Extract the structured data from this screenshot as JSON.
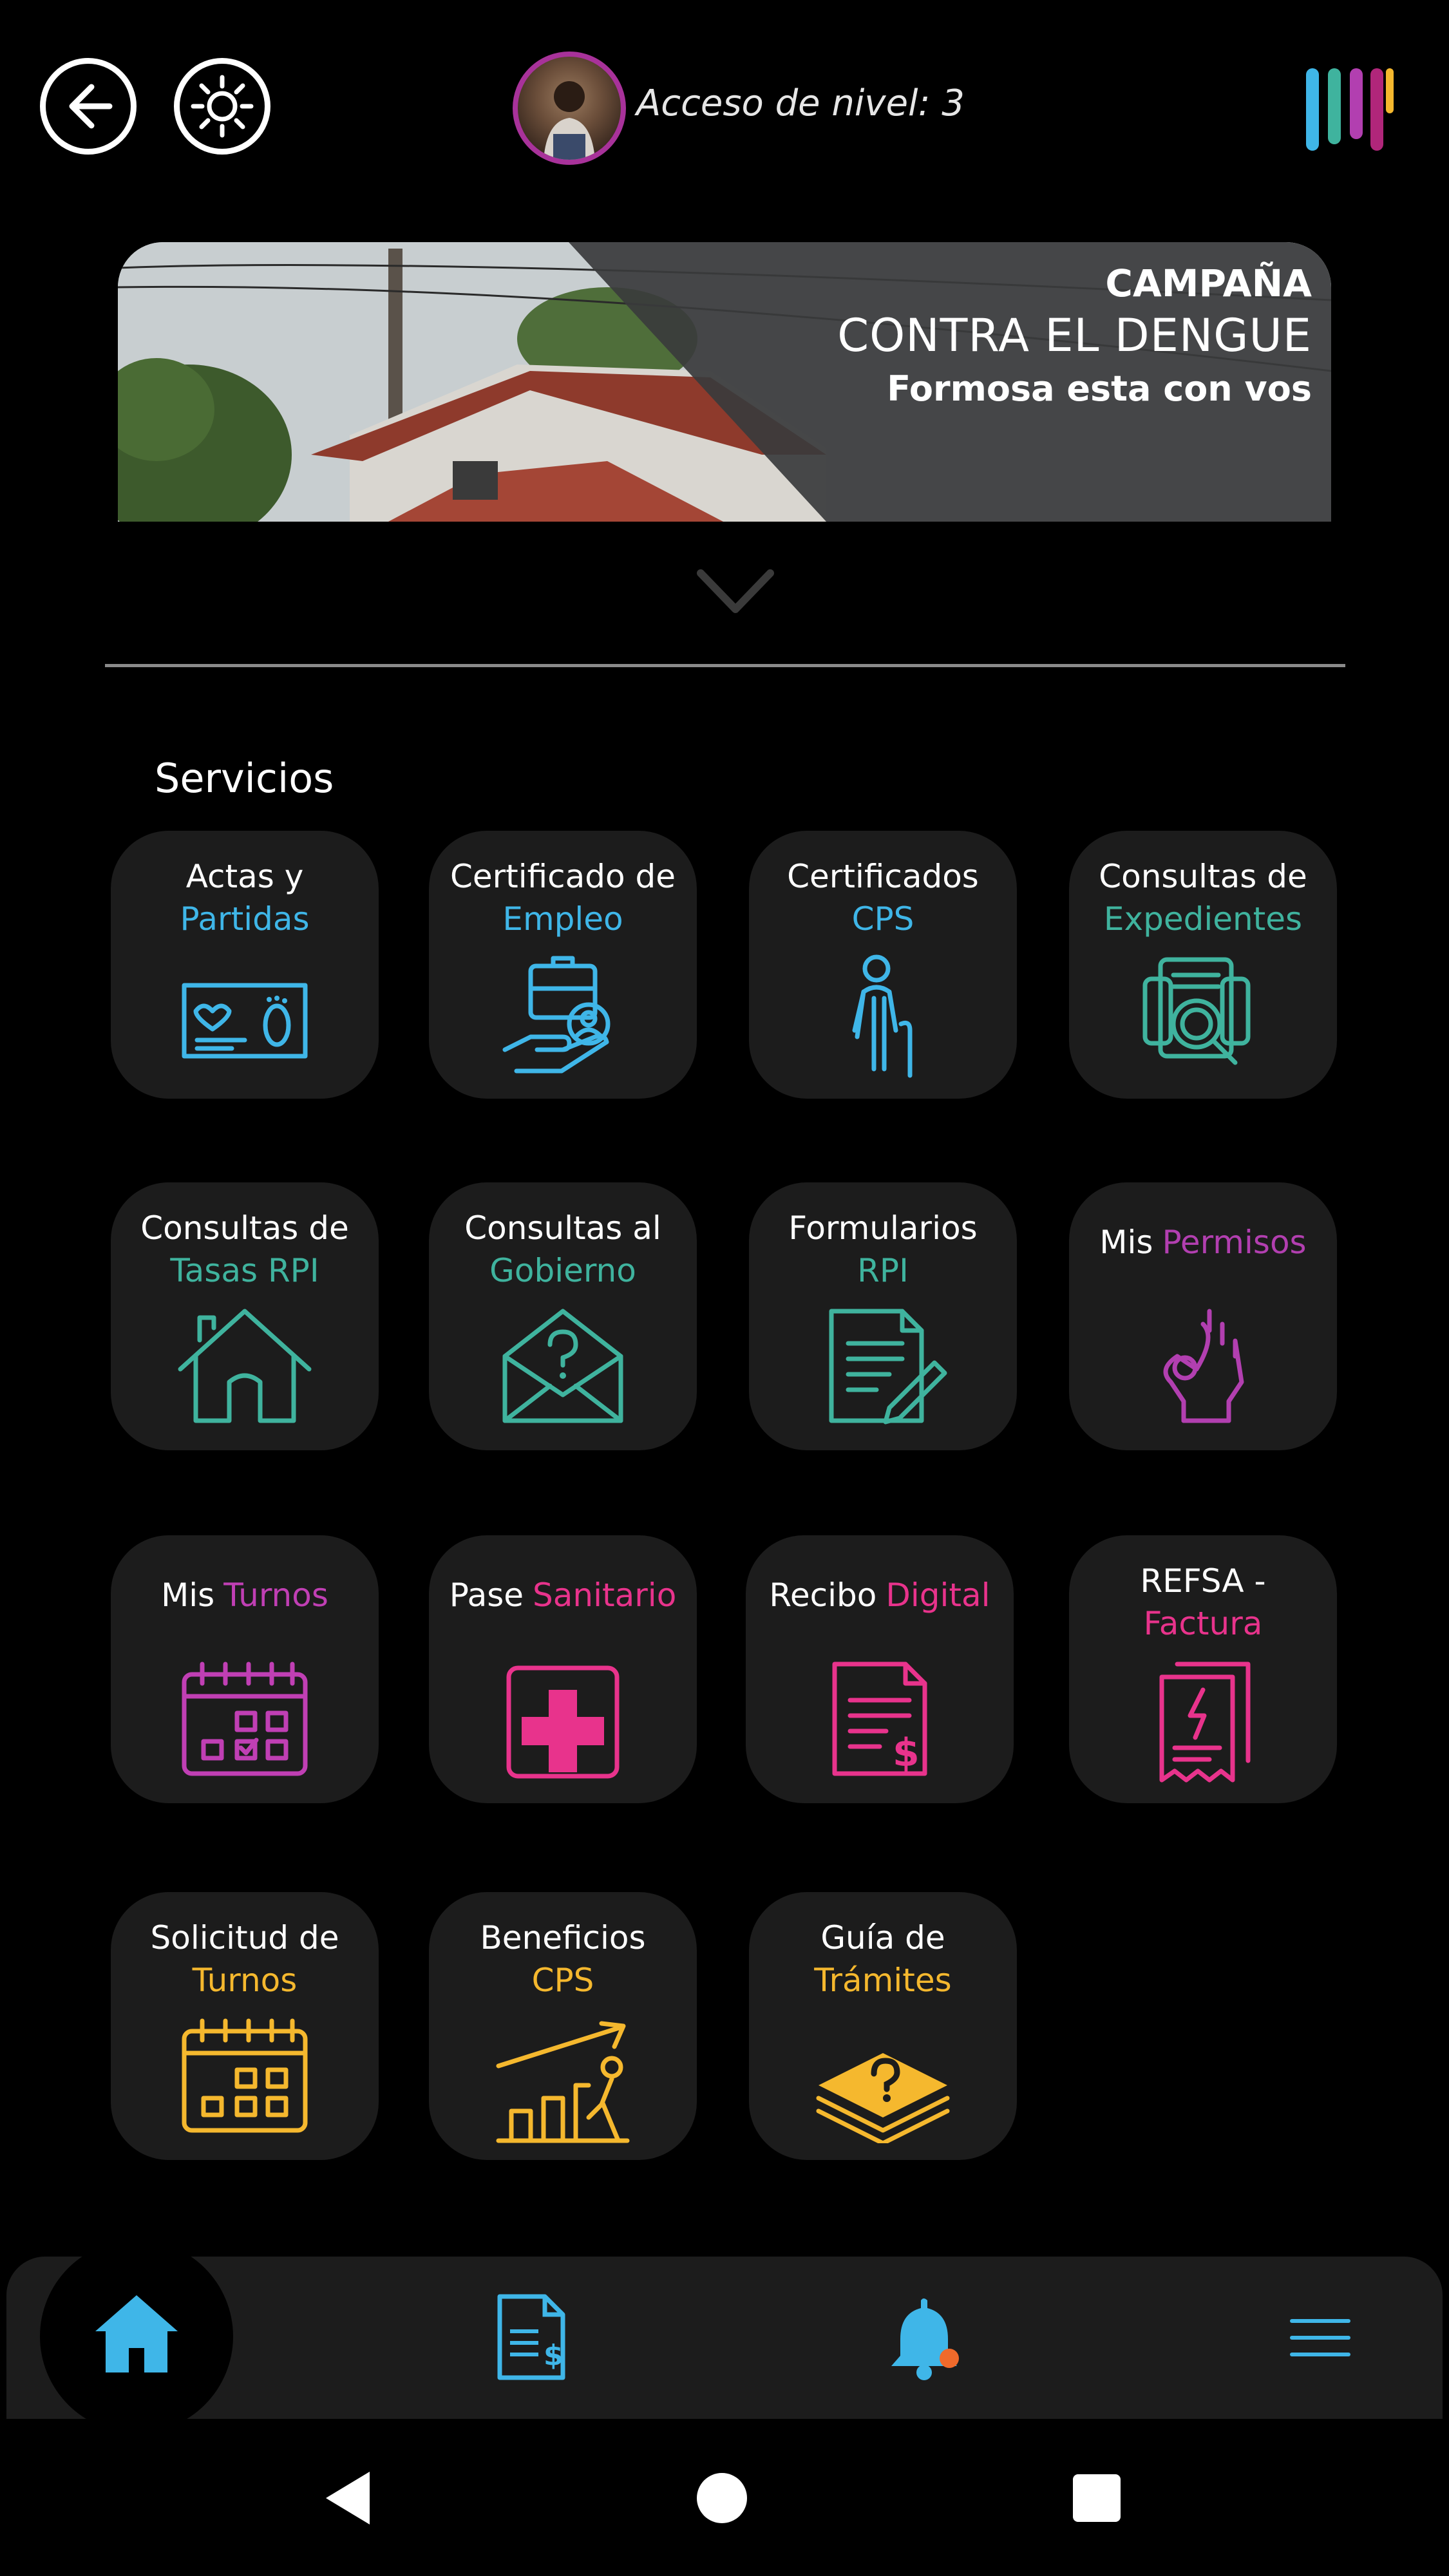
{
  "header": {
    "access_label": "Acceso de nivel: 3",
    "back_icon": "arrow-left-icon",
    "theme_icon": "sun-icon"
  },
  "banner": {
    "line1": "CAMPAÑA",
    "line2": "CONTRA EL DENGUE",
    "line3": "Formosa esta con vos"
  },
  "section": {
    "title": "Servicios"
  },
  "services": [
    {
      "l1": "Actas y",
      "l2": "Partidas",
      "color": "#3fb6e8",
      "icon": "birth-certificate-icon"
    },
    {
      "l1": "Certificado de",
      "l2": "Empleo",
      "color": "#3fb6e8",
      "icon": "employment-hand-icon"
    },
    {
      "l1": "Certificados",
      "l2": "CPS",
      "color": "#3fb6e8",
      "icon": "elderly-person-icon"
    },
    {
      "l1": "Consultas de",
      "l2": "Expedientes",
      "color": "#3fb39e",
      "icon": "document-search-icon"
    },
    {
      "l1": "Consultas de",
      "l2": "Tasas RPI",
      "color": "#3fb39e",
      "icon": "house-icon"
    },
    {
      "l1": "Consultas al",
      "l2": "Gobierno",
      "color": "#3fb39e",
      "icon": "envelope-question-icon"
    },
    {
      "l1": "Formularios",
      "l2": "RPI",
      "color": "#3fb39e",
      "icon": "form-pencil-icon"
    },
    {
      "l1": "Mis",
      "l2": "Permisos",
      "color": "#b23fb0",
      "icon": "ok-hand-icon",
      "inline": true
    },
    {
      "l1": "Mis",
      "l2": "Turnos",
      "color": "#c03fb4",
      "icon": "calendar-check-icon",
      "inline": true
    },
    {
      "l1": "Pase",
      "l2": "Sanitario",
      "color": "#e8338c",
      "icon": "medical-cross-icon",
      "inline": true
    },
    {
      "l1": "Recibo",
      "l2": "Digital",
      "color": "#e8338c",
      "icon": "receipt-dollar-icon",
      "inline": true
    },
    {
      "l1": "REFSA -",
      "l2": "Factura",
      "color": "#e8338c",
      "icon": "invoice-bolt-icon"
    },
    {
      "l1": "Solicitud de",
      "l2": "Turnos",
      "color": "#f5b82e",
      "icon": "calendar-icon"
    },
    {
      "l1": "Beneficios",
      "l2": "CPS",
      "color": "#f5b82e",
      "icon": "growth-chart-icon"
    },
    {
      "l1": "Guía de",
      "l2": "Trámites",
      "color": "#f5b82e",
      "icon": "stack-question-icon"
    }
  ],
  "nav": {
    "home_icon": "home-icon",
    "bills_icon": "bill-icon",
    "notifications_icon": "bell-icon",
    "menu_icon": "hamburger-menu-icon"
  },
  "colors": {
    "blue": "#3fb6e8",
    "teal": "#3fb39e",
    "purple": "#b23fb0",
    "pink": "#e8338c",
    "yellow": "#f5b82e"
  }
}
